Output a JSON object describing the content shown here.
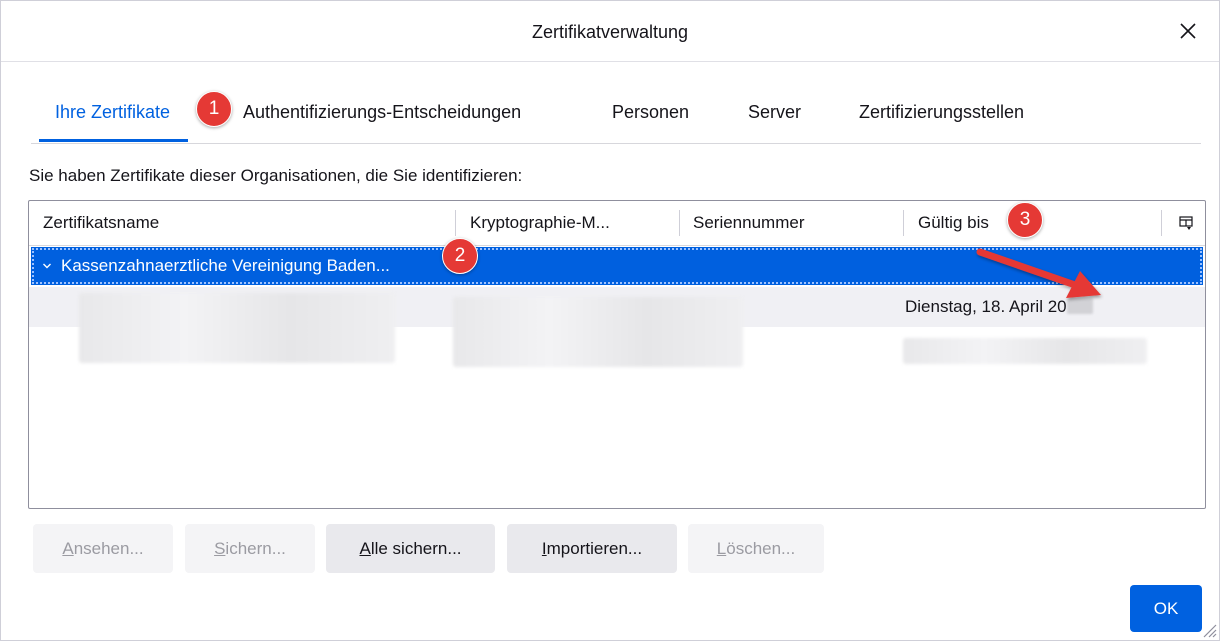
{
  "dialog": {
    "title": "Zertifikatverwaltung",
    "close_icon": "close-icon"
  },
  "tabs": [
    {
      "label": "Ihre Zertifikate",
      "active": true
    },
    {
      "label": "Authentifizierungs-Entscheidungen",
      "active": false
    },
    {
      "label": "Personen",
      "active": false
    },
    {
      "label": "Server",
      "active": false
    },
    {
      "label": "Zertifizierungsstellen",
      "active": false
    }
  ],
  "intro_text": "Sie haben Zertifikate dieser Organisationen, die Sie identifizieren:",
  "table": {
    "columns": [
      "Zertifikatsname",
      "Kryptographie-M...",
      "Seriennummer",
      "Gültig bis"
    ],
    "column_picker_icon": "column-picker-icon",
    "group": {
      "label": "Kassenzahnaerztliche Vereinigung Baden...",
      "expanded": true,
      "twisty_icon": "chevron-down-icon"
    },
    "child": {
      "valid_until": "Dienstag, 18. April 20"
    }
  },
  "buttons": [
    {
      "accel": "A",
      "rest": "nsehen...",
      "enabled": false
    },
    {
      "accel": "S",
      "rest": "ichern...",
      "enabled": false
    },
    {
      "accel": "A",
      "rest": "lle sichern...",
      "enabled": true
    },
    {
      "accel": "I",
      "rest": "mportieren...",
      "enabled": true
    },
    {
      "accel": "L",
      "rest": "öschen...",
      "enabled": false
    }
  ],
  "ok_label": "OK",
  "annotations": [
    "1",
    "2",
    "3"
  ],
  "colors": {
    "accent": "#0061e0",
    "selection": "#0060df",
    "badge": "#e53935"
  }
}
